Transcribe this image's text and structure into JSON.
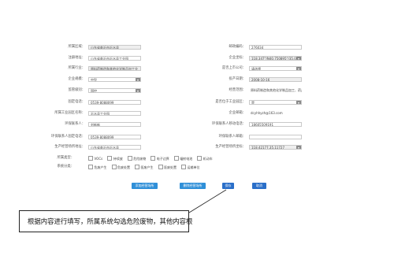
{
  "form": {
    "left": [
      {
        "label": "所属区域：",
        "value": "山东省临沂市沂水县",
        "kind": "grey"
      },
      {
        "label": "注册地址：",
        "value": "山东省临沂市沂水县工业园",
        "kind": "text"
      },
      {
        "label": "所属行业：",
        "value": "原料药制造和其他化学制品加工业",
        "kind": "grey"
      },
      {
        "label": "企业规模：",
        "value": "中型",
        "kind": "select"
      },
      {
        "label": "监管级别：",
        "value": "国控",
        "kind": "select"
      },
      {
        "label": "固定电话：",
        "value": "0539-8088099",
        "kind": "text"
      },
      {
        "label": "所属工业园区名称：",
        "value": "沂水县工业园",
        "kind": "text"
      },
      {
        "label": "环保联系人：",
        "value": "刘新新",
        "kind": "text"
      },
      {
        "label": "环保联系人固定电话：",
        "value": "0539-8088099",
        "kind": "text"
      },
      {
        "label": "生产经营场所地址：",
        "value": "山东省临沂市沂水县",
        "kind": "text"
      }
    ],
    "right": [
      {
        "label": "邮政编码：",
        "value": "276034",
        "kind": "text"
      },
      {
        "label": "企业坐标：",
        "value": "118.347°/N40.750895°/35.09",
        "kind": "grey-select"
      },
      {
        "label": "是否上市公司：",
        "value": "请选择",
        "kind": "select"
      },
      {
        "label": "投产日期：",
        "value": "2008-10-16",
        "kind": "grey"
      },
      {
        "label": "经营范围：",
        "value": "原料药制造和其他化学制品加工、药品、化",
        "kind": "plain"
      },
      {
        "label": "是否位于工业园区：",
        "value": "是",
        "kind": "select"
      },
      {
        "label": "企业邮箱：",
        "value": "dcyhhyzh@163.com",
        "kind": "plain"
      },
      {
        "label": "环保联系人移动电话：",
        "value": "18605509191",
        "kind": "text"
      },
      {
        "label": "环保联系人邮箱：",
        "value": "",
        "kind": "text"
      },
      {
        "label": "生产经营场所坐标：",
        "value": "118.42177,35.11727",
        "kind": "grey-select"
      }
    ],
    "pollutant_label": "所属类型：",
    "pollutant_options": [
      "VOCs",
      "持续放",
      "危险废物",
      "电子边界",
      "辐射电池",
      "机动车"
    ],
    "system_label": "系统分类：",
    "system_options": [
      "危废产生",
      "危废处置",
      "医废产生",
      "医废处置",
      "运输单位"
    ]
  },
  "buttons": {
    "b1": "添加经营场所",
    "b2": "删除经营场所",
    "b3": "保存",
    "b4": "取消"
  },
  "tooltip": {
    "text": "根据内容进行填写，所属系统勾选危险废物，其他内容根"
  }
}
